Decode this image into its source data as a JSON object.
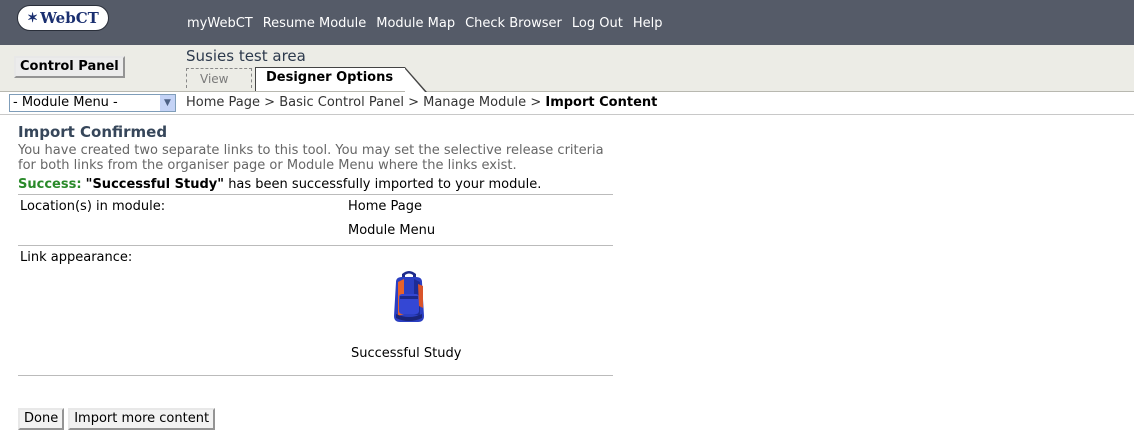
{
  "logo": {
    "text": "WebCT"
  },
  "topnav": [
    "myWebCT",
    "Resume Module",
    "Module Map",
    "Check Browser",
    "Log Out",
    "Help"
  ],
  "header": {
    "control_panel": "Control Panel",
    "area_title": "Susies test area",
    "tab_view": "View",
    "tab_designer": "Designer Options"
  },
  "nav": {
    "module_menu": "- Module Menu -",
    "crumbs": [
      "Home Page",
      "Basic Control Panel",
      "Manage Module"
    ],
    "crumb_current": "Import Content",
    "separator": ">"
  },
  "main": {
    "heading": "Import Confirmed",
    "description": "You have created two separate links to this tool. You may set the selective release criteria for both links from the organiser page or Module Menu where the links exist.",
    "success_label": "Success:",
    "success_item": "\"Successful Study\"",
    "success_text": "has been successfully imported to your module.",
    "location_label": "Location(s) in module:",
    "locations": [
      "Home Page",
      "Module Menu"
    ],
    "appearance_label": "Link appearance:",
    "icon_name": "backpack-icon",
    "icon_caption": "Successful Study"
  },
  "buttons": {
    "done": "Done",
    "import_more": "Import more content"
  },
  "colors": {
    "topbar": "#555b68",
    "header": "#ecece6",
    "success": "#2a8a2a",
    "heading": "#36465a"
  }
}
